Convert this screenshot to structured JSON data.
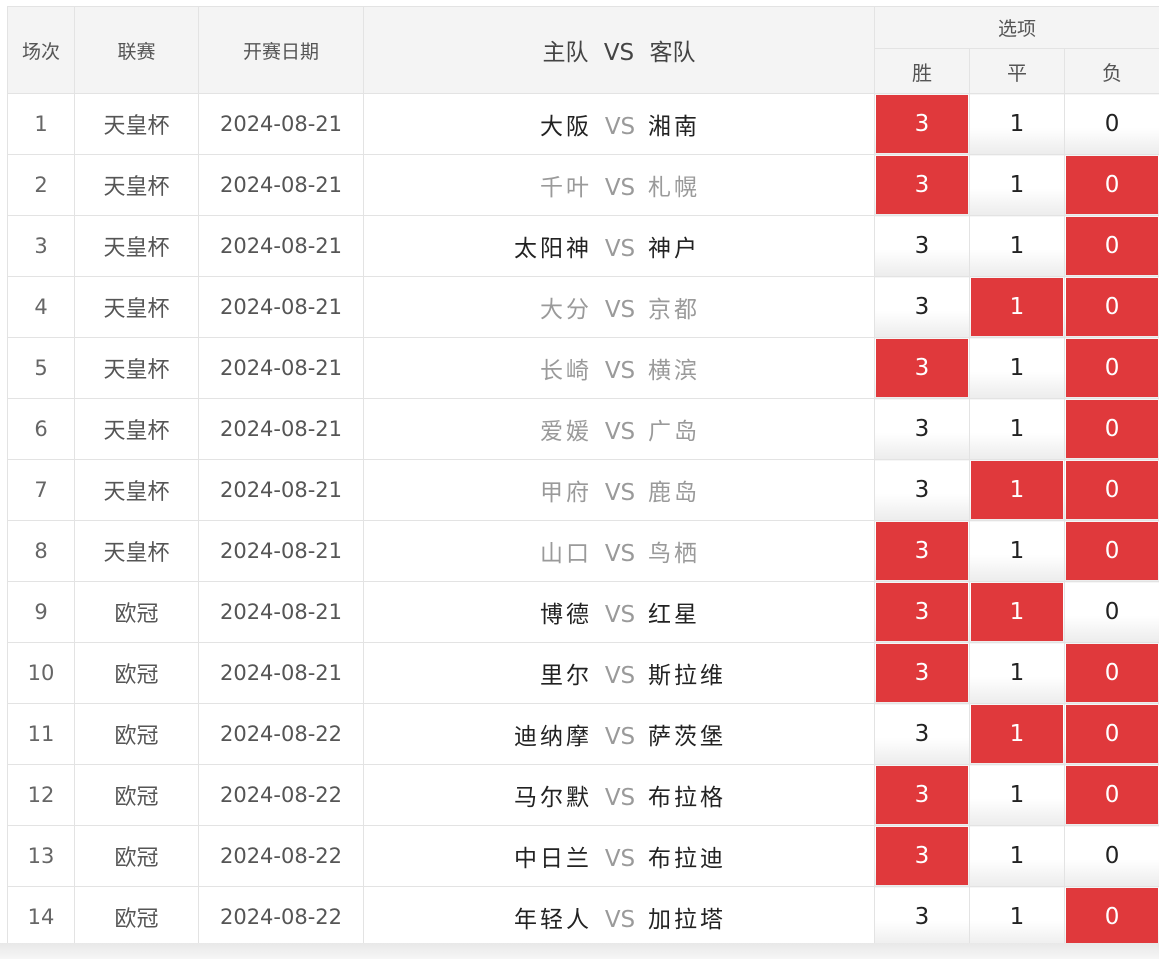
{
  "headers": {
    "num": "场次",
    "league": "联赛",
    "date": "开赛日期",
    "home": "主队",
    "vs": "VS",
    "away": "客队",
    "options": "选项",
    "win": "胜",
    "draw": "平",
    "lose": "负"
  },
  "colors": {
    "selected": "#e0393c",
    "muted_text": "#9a9a9a"
  },
  "rows": [
    {
      "num": "1",
      "league": "天皇杯",
      "date": "2024-08-21",
      "home": "大阪",
      "away": "湘南",
      "home_muted": false,
      "away_muted": false,
      "win": "3",
      "draw": "1",
      "lose": "0",
      "sel": [
        true,
        false,
        false
      ]
    },
    {
      "num": "2",
      "league": "天皇杯",
      "date": "2024-08-21",
      "home": "千叶",
      "away": "札幌",
      "home_muted": true,
      "away_muted": true,
      "win": "3",
      "draw": "1",
      "lose": "0",
      "sel": [
        true,
        false,
        true
      ]
    },
    {
      "num": "3",
      "league": "天皇杯",
      "date": "2024-08-21",
      "home": "太阳神",
      "away": "神户",
      "home_muted": false,
      "away_muted": false,
      "win": "3",
      "draw": "1",
      "lose": "0",
      "sel": [
        false,
        false,
        true
      ]
    },
    {
      "num": "4",
      "league": "天皇杯",
      "date": "2024-08-21",
      "home": "大分",
      "away": "京都",
      "home_muted": true,
      "away_muted": true,
      "win": "3",
      "draw": "1",
      "lose": "0",
      "sel": [
        false,
        true,
        true
      ]
    },
    {
      "num": "5",
      "league": "天皇杯",
      "date": "2024-08-21",
      "home": "长崎",
      "away": "横滨",
      "home_muted": true,
      "away_muted": true,
      "win": "3",
      "draw": "1",
      "lose": "0",
      "sel": [
        true,
        false,
        true
      ]
    },
    {
      "num": "6",
      "league": "天皇杯",
      "date": "2024-08-21",
      "home": "爱媛",
      "away": "广岛",
      "home_muted": true,
      "away_muted": true,
      "win": "3",
      "draw": "1",
      "lose": "0",
      "sel": [
        false,
        false,
        true
      ]
    },
    {
      "num": "7",
      "league": "天皇杯",
      "date": "2024-08-21",
      "home": "甲府",
      "away": "鹿岛",
      "home_muted": true,
      "away_muted": true,
      "win": "3",
      "draw": "1",
      "lose": "0",
      "sel": [
        false,
        true,
        true
      ]
    },
    {
      "num": "8",
      "league": "天皇杯",
      "date": "2024-08-21",
      "home": "山口",
      "away": "鸟栖",
      "home_muted": true,
      "away_muted": true,
      "win": "3",
      "draw": "1",
      "lose": "0",
      "sel": [
        true,
        false,
        true
      ]
    },
    {
      "num": "9",
      "league": "欧冠",
      "date": "2024-08-21",
      "home": "博德",
      "away": "红星",
      "home_muted": false,
      "away_muted": false,
      "win": "3",
      "draw": "1",
      "lose": "0",
      "sel": [
        true,
        true,
        false
      ]
    },
    {
      "num": "10",
      "league": "欧冠",
      "date": "2024-08-21",
      "home": "里尔",
      "away": "斯拉维",
      "home_muted": false,
      "away_muted": false,
      "win": "3",
      "draw": "1",
      "lose": "0",
      "sel": [
        true,
        false,
        true
      ]
    },
    {
      "num": "11",
      "league": "欧冠",
      "date": "2024-08-22",
      "home": "迪纳摩",
      "away": "萨茨堡",
      "home_muted": false,
      "away_muted": false,
      "win": "3",
      "draw": "1",
      "lose": "0",
      "sel": [
        false,
        true,
        true
      ]
    },
    {
      "num": "12",
      "league": "欧冠",
      "date": "2024-08-22",
      "home": "马尔默",
      "away": "布拉格",
      "home_muted": false,
      "away_muted": false,
      "win": "3",
      "draw": "1",
      "lose": "0",
      "sel": [
        true,
        false,
        true
      ]
    },
    {
      "num": "13",
      "league": "欧冠",
      "date": "2024-08-22",
      "home": "中日兰",
      "away": "布拉迪",
      "home_muted": false,
      "away_muted": false,
      "win": "3",
      "draw": "1",
      "lose": "0",
      "sel": [
        true,
        false,
        false
      ]
    },
    {
      "num": "14",
      "league": "欧冠",
      "date": "2024-08-22",
      "home": "年轻人",
      "away": "加拉塔",
      "home_muted": false,
      "away_muted": false,
      "win": "3",
      "draw": "1",
      "lose": "0",
      "sel": [
        false,
        false,
        true
      ]
    }
  ]
}
